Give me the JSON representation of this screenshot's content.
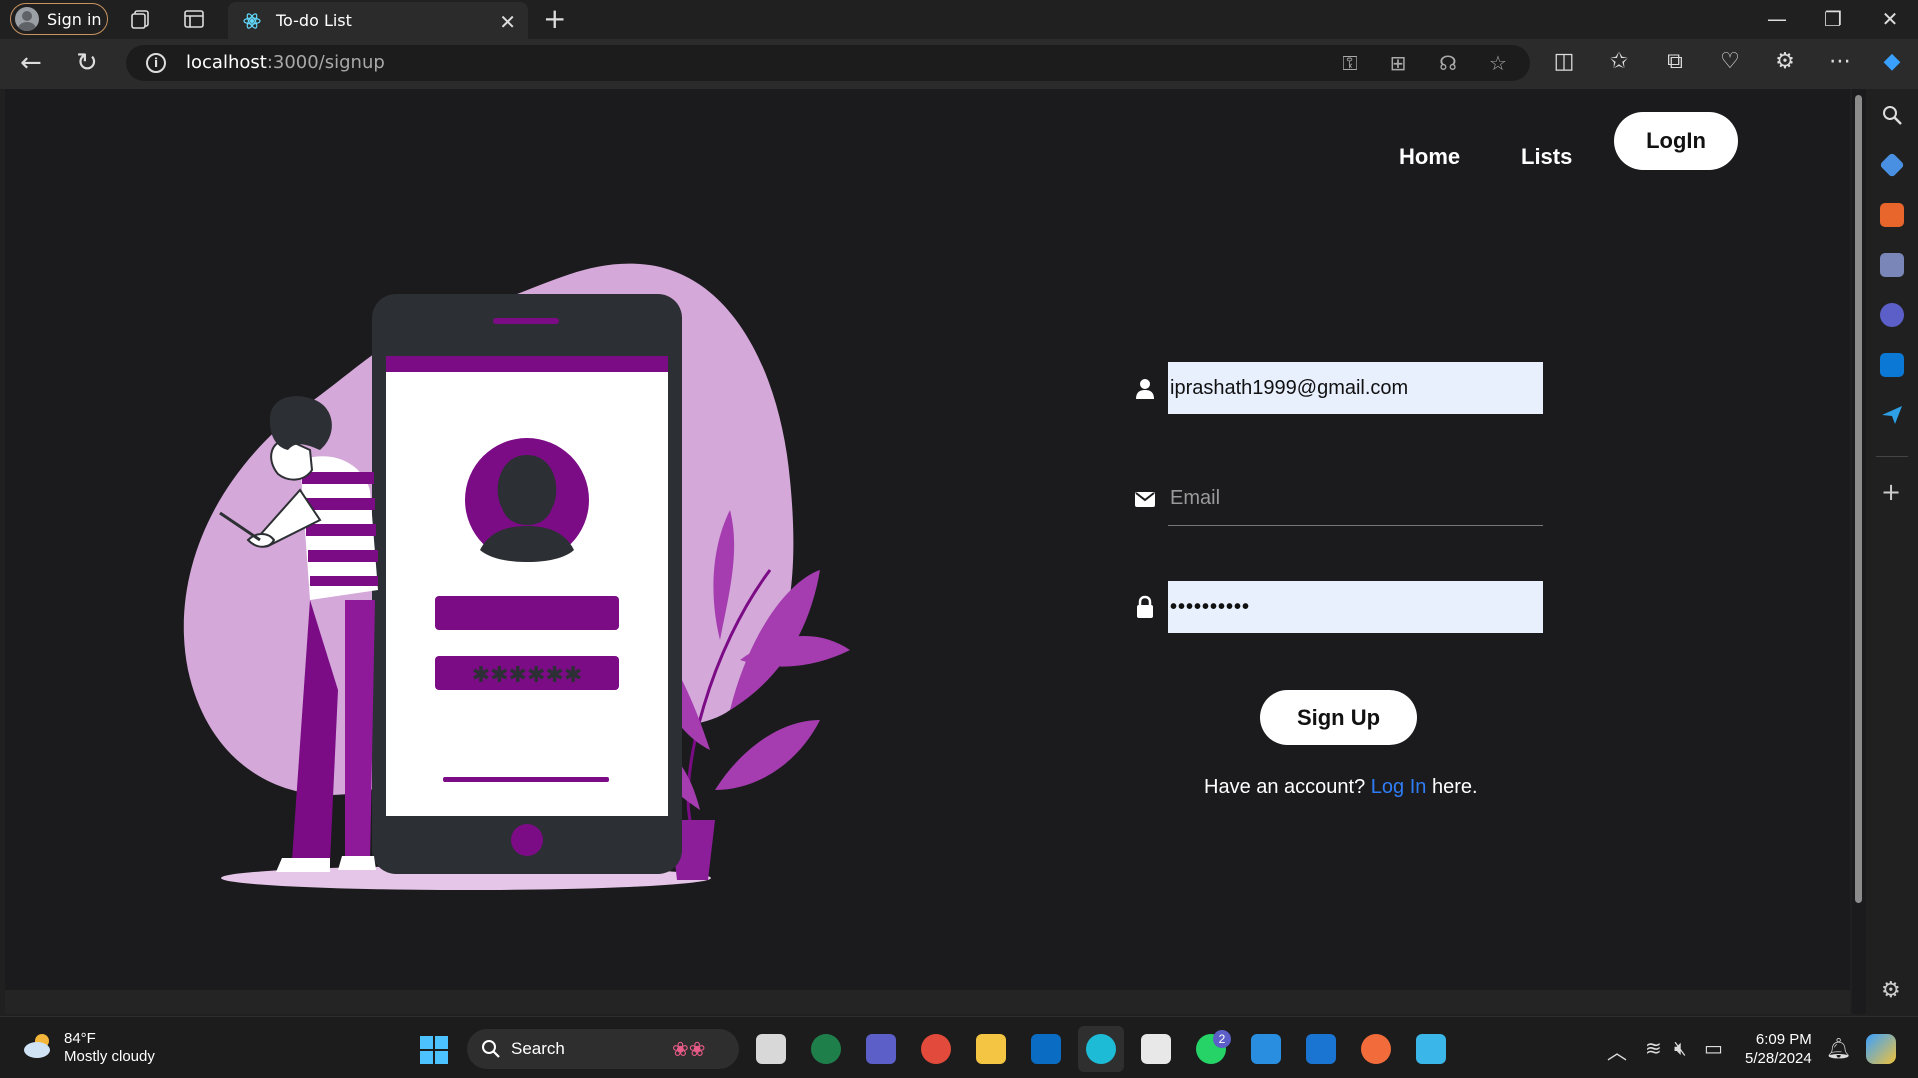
{
  "browser": {
    "signin_label": "Sign in",
    "tab_title": "To-do List",
    "url_host": "localhost",
    "url_path": ":3000/signup"
  },
  "nav": {
    "home": "Home",
    "lists": "Lists",
    "login": "LogIn"
  },
  "form": {
    "username_value": "iprashath1999@gmail.com",
    "email_placeholder": "Email",
    "password_value": "••••••••••",
    "signup_label": "Sign Up",
    "have_account": "Have an account?",
    "login_link": "Log In",
    "here": "here."
  },
  "illustration": {
    "accent": "#7b0c86",
    "blob": "#d4a8d9",
    "phone": "#2c2f33"
  },
  "taskbar": {
    "temp": "84°F",
    "weather": "Mostly cloudy",
    "search_label": "Search",
    "time": "6:09 PM",
    "date": "5/28/2024",
    "whatsapp_badge": "2"
  }
}
